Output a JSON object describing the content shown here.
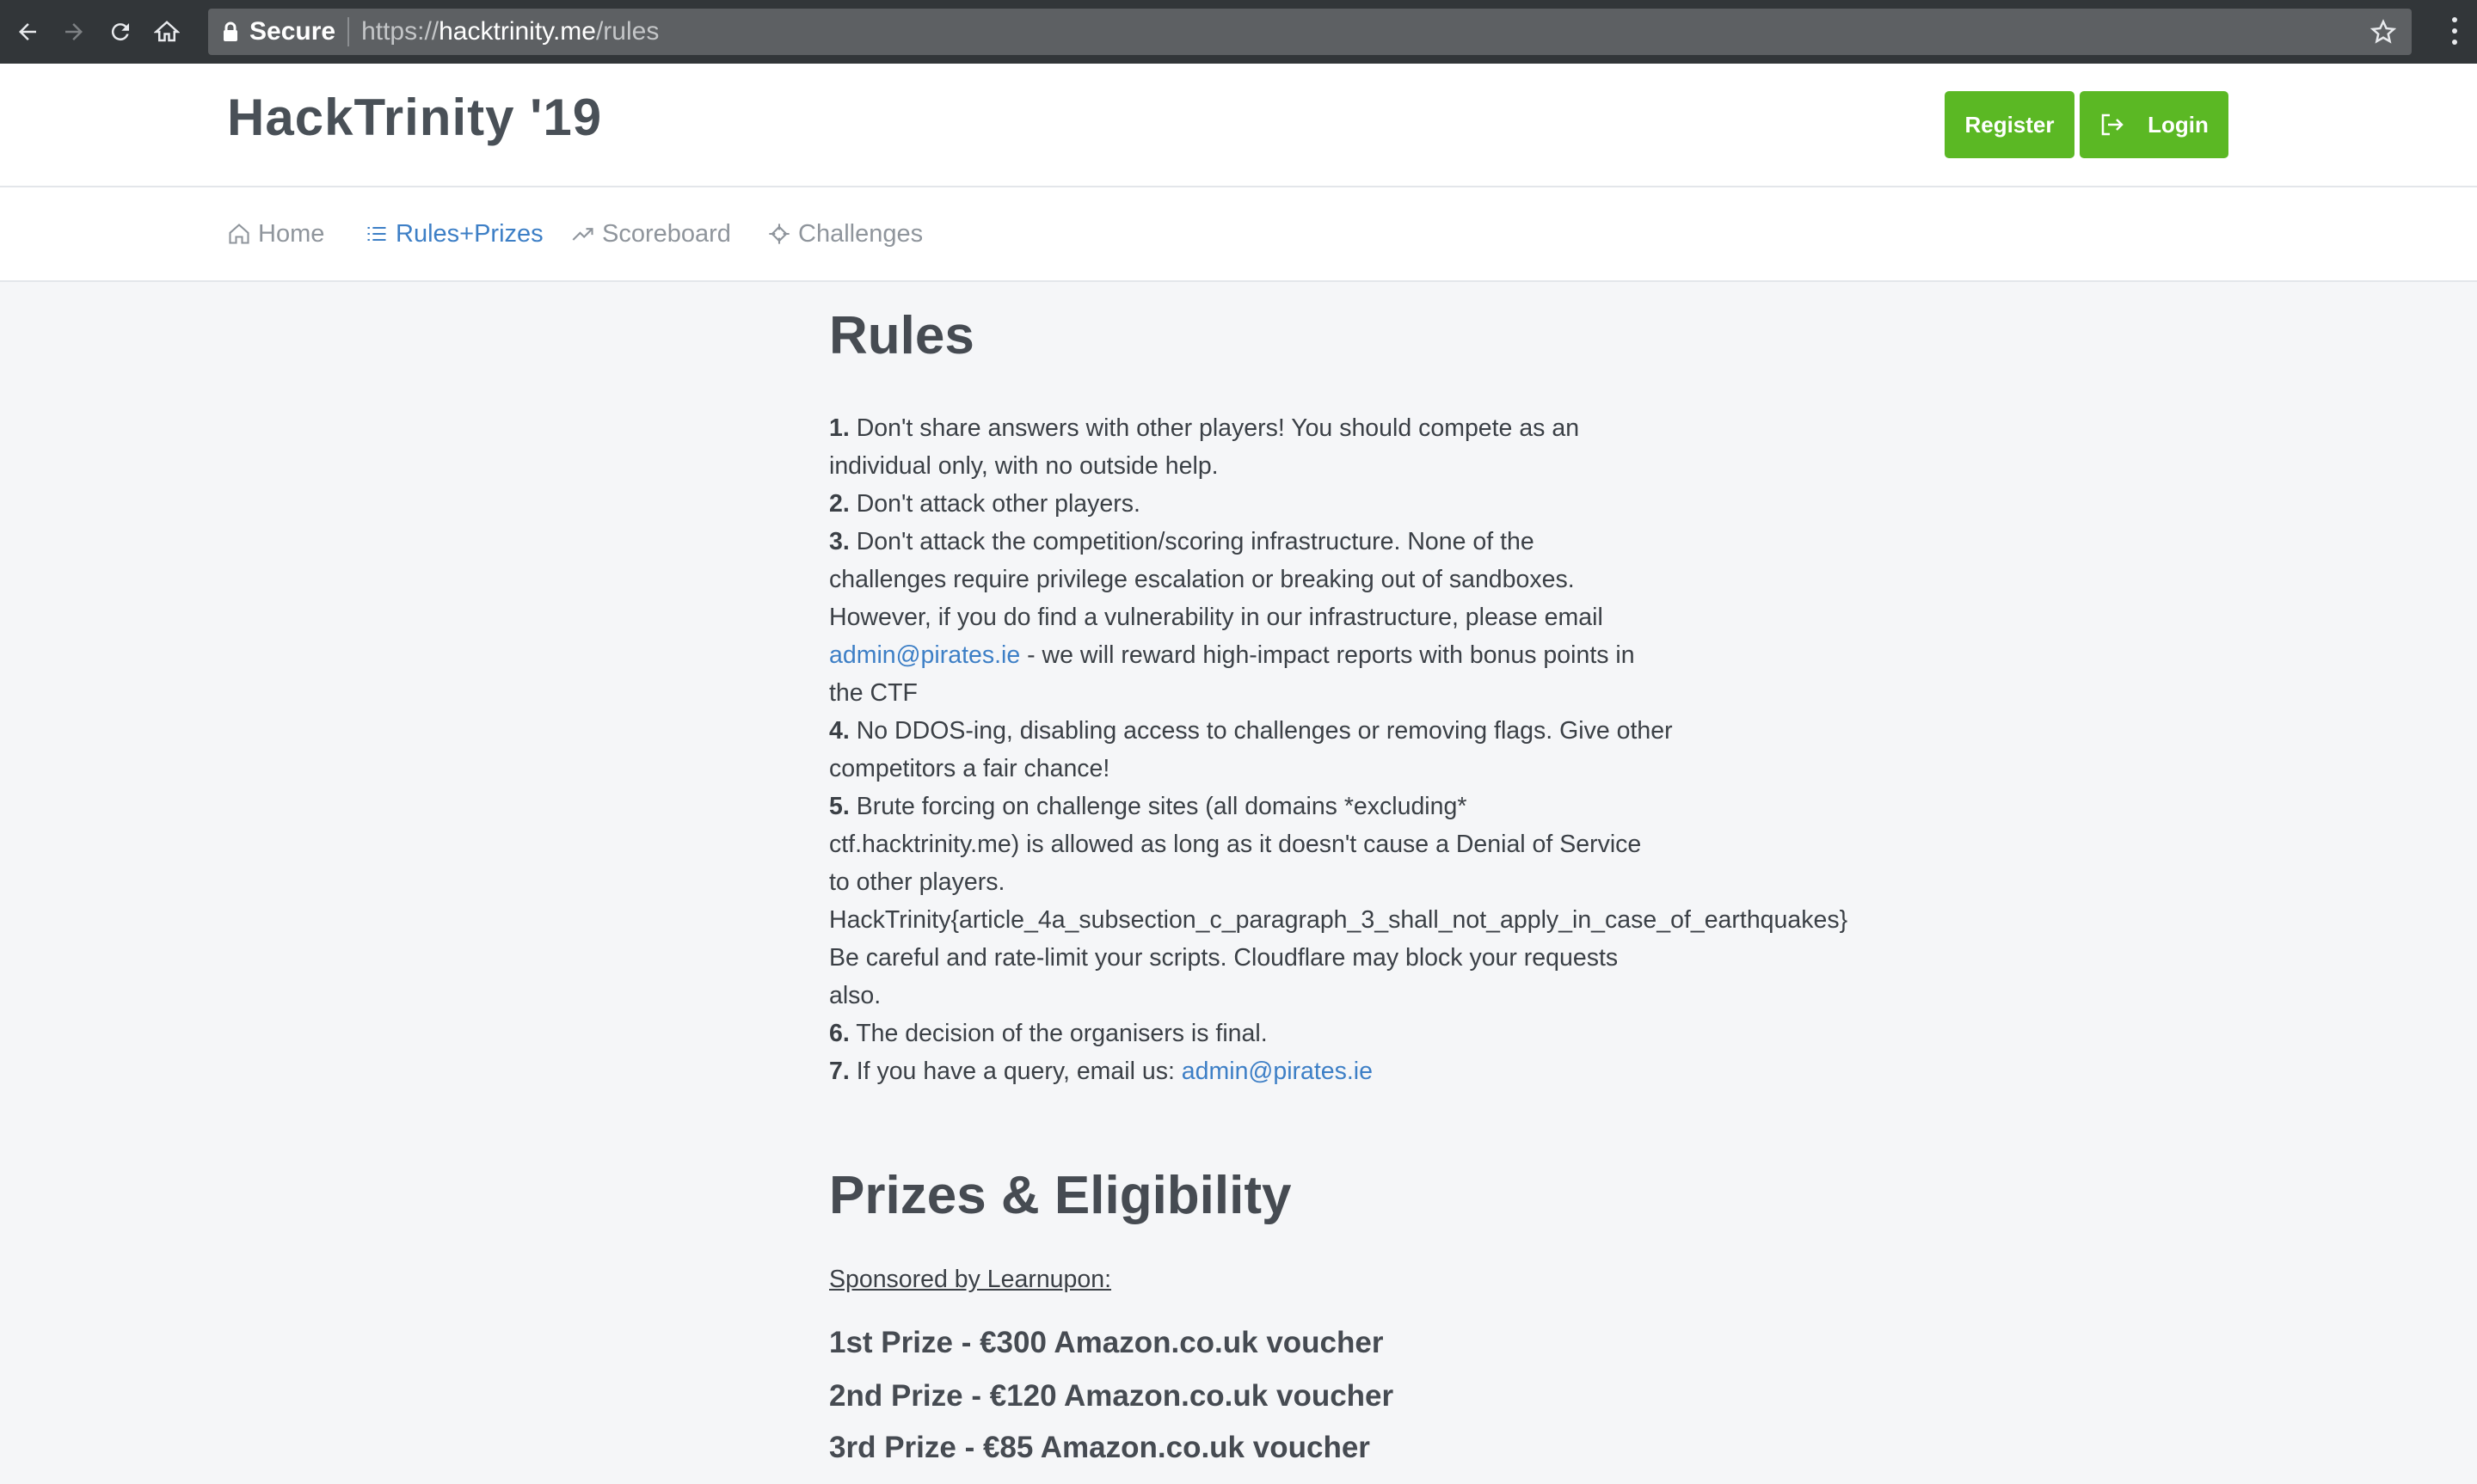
{
  "browser": {
    "secure_label": "Secure",
    "url_scheme": "https://",
    "url_host": "hacktrinity.me",
    "url_path": "/rules"
  },
  "header": {
    "brand": "HackTrinity '19",
    "register_label": "Register",
    "login_label": "Login",
    "accent_color": "#5bb824"
  },
  "nav": {
    "home": "Home",
    "rules": "Rules+Prizes",
    "scoreboard": "Scoreboard",
    "challenges": "Challenges",
    "active_color": "#3d7fc6"
  },
  "rules": {
    "title": "Rules",
    "r1_num": "1.",
    "r1_a": "Don't share answers with other players! You should compete as an",
    "r1_b": "individual only, with no outside help.",
    "r2_num": "2.",
    "r2": "Don't attack other players.",
    "r3_num": "3.",
    "r3_a": "Don't attack the competition/scoring infrastructure. None of the",
    "r3_b": "challenges require privilege escalation or breaking out of sandboxes.",
    "r3_c": "However, if you do find a vulnerability in our infrastructure, please email",
    "r3_email": "admin@pirates.ie",
    "r3_d": " - we will reward high-impact reports with bonus points in",
    "r3_e": "the CTF",
    "r4_num": "4.",
    "r4_a": "No DDOS-ing, disabling access to challenges or removing flags. Give other",
    "r4_b": "competitors a fair chance!",
    "r5_num": "5.",
    "r5_a": "Brute forcing on challenge sites (all domains *excluding*",
    "r5_b": "ctf.hacktrinity.me) is allowed as long as it doesn't cause a Denial of Service",
    "r5_c": "to other players.",
    "r5_flag": "HackTrinity{article_4a_subsection_c_paragraph_3_shall_not_apply_in_case_of_earthquakes}",
    "r5_d": "Be careful and rate-limit your scripts. Cloudflare may block your requests",
    "r5_e": "also.",
    "r6_num": "6.",
    "r6": "The decision of the organisers is final.",
    "r7_num": "7.",
    "r7": "If you have a query, email us: ",
    "r7_email": "admin@pirates.ie"
  },
  "prizes": {
    "title": "Prizes & Eligibility",
    "sponsor": "Sponsored by Learnupon:",
    "first": "1st Prize - €300 Amazon.co.uk voucher",
    "second": "2nd Prize - €120 Amazon.co.uk voucher",
    "third": "3rd Prize - €85 Amazon.co.uk voucher"
  }
}
